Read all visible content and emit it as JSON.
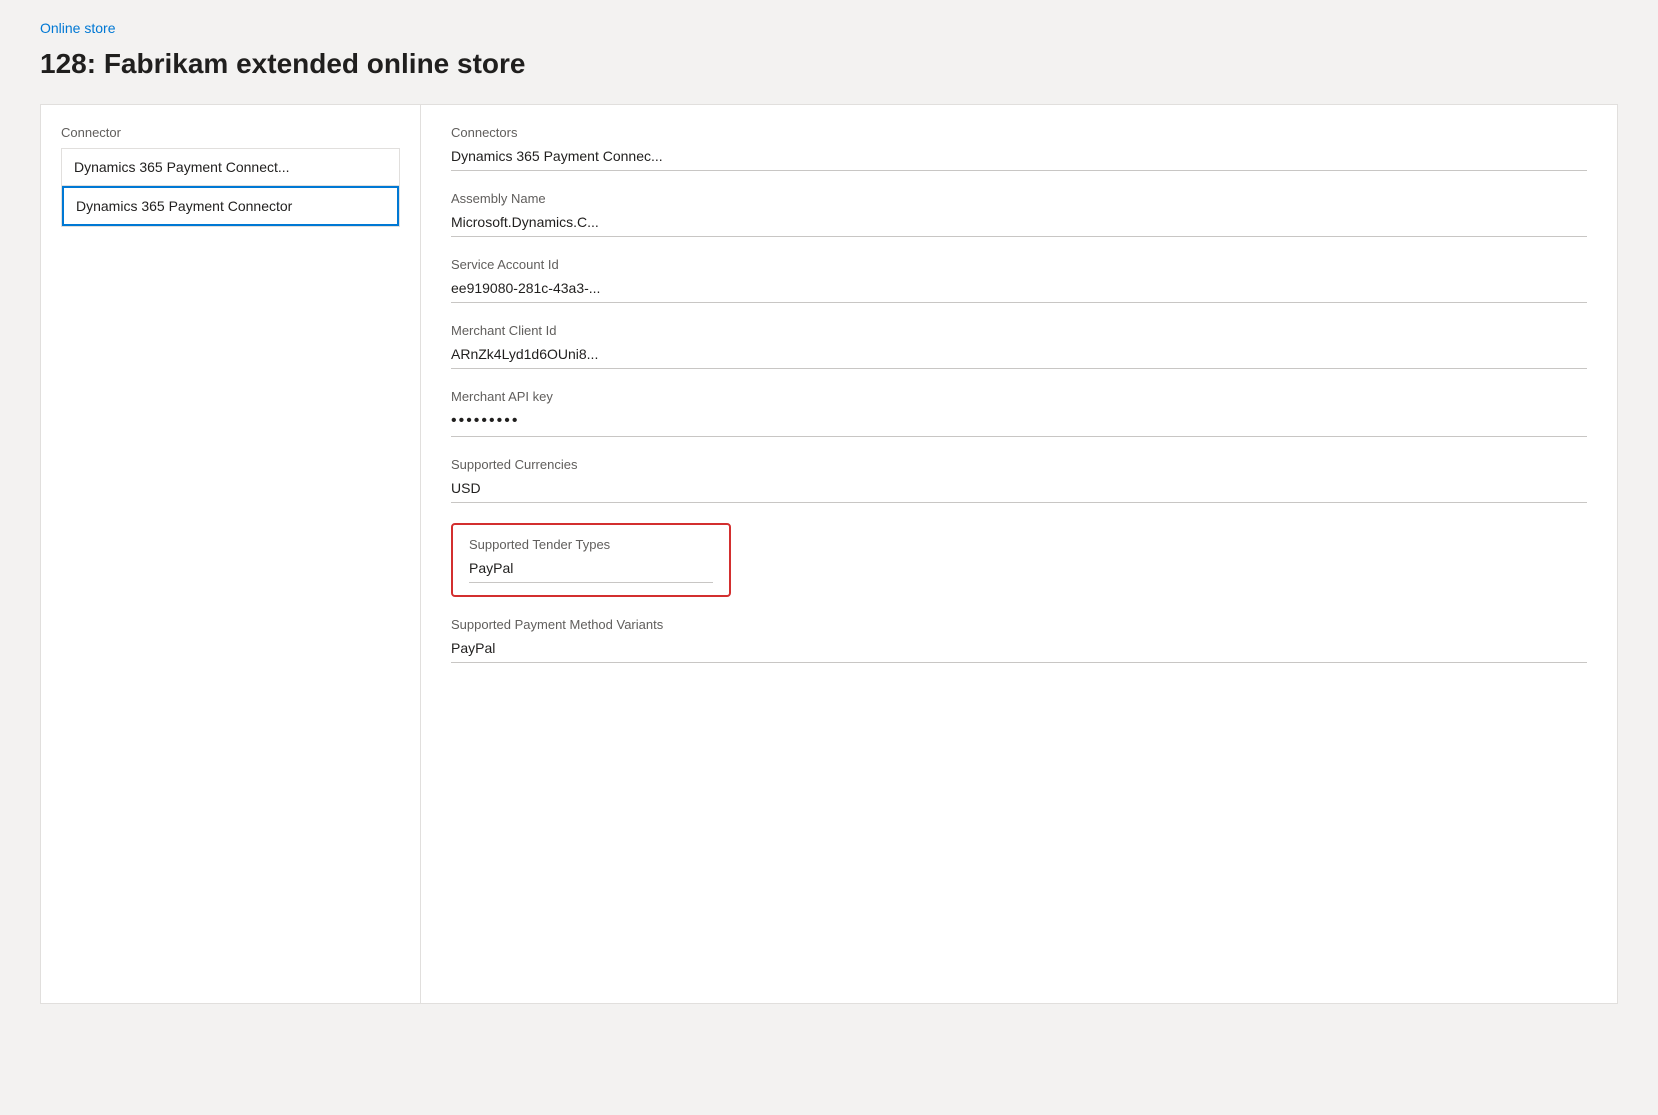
{
  "breadcrumb": {
    "label": "Online store",
    "href": "#"
  },
  "page_title": "128: Fabrikam extended online store",
  "left_panel": {
    "label": "Connector",
    "items": [
      {
        "id": "item1",
        "text": "Dynamics 365 Payment Connect...",
        "selected": false
      },
      {
        "id": "item2",
        "text": "Dynamics 365 Payment Connector",
        "selected": true
      }
    ]
  },
  "right_panel": {
    "fields": [
      {
        "id": "connectors",
        "label": "Connectors",
        "value": "Dynamics 365 Payment Connec...",
        "type": "text"
      },
      {
        "id": "assembly_name",
        "label": "Assembly Name",
        "value": "Microsoft.Dynamics.C...",
        "type": "text"
      },
      {
        "id": "service_account_id",
        "label": "Service Account Id",
        "value": "ee919080-281c-43a3-...",
        "type": "text"
      },
      {
        "id": "merchant_client_id",
        "label": "Merchant Client Id",
        "value": "ARnZk4Lyd1d6OUni8...",
        "type": "text"
      },
      {
        "id": "merchant_api_key",
        "label": "Merchant API key",
        "value": "•••••••••",
        "type": "password"
      },
      {
        "id": "supported_currencies",
        "label": "Supported Currencies",
        "value": "USD",
        "type": "text"
      }
    ],
    "highlighted_field": {
      "label": "Supported Tender Types",
      "value": "PayPal"
    },
    "last_field": {
      "label": "Supported Payment Method Variants",
      "value": "PayPal"
    }
  }
}
